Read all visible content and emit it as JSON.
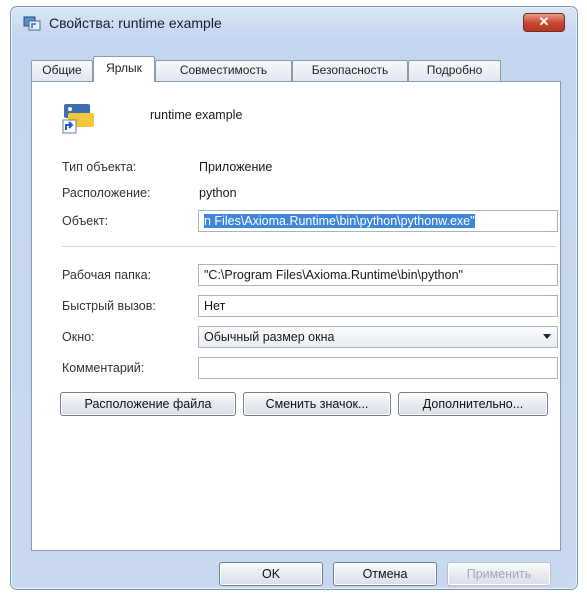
{
  "window": {
    "title": "Свойства: runtime example",
    "close_label": "✕"
  },
  "tabs": [
    {
      "label": "Общие",
      "active": false
    },
    {
      "label": "Ярлык",
      "active": true
    },
    {
      "label": "Совместимость",
      "active": false
    },
    {
      "label": "Безопасность",
      "active": false
    },
    {
      "label": "Подробно",
      "active": false
    }
  ],
  "shortcut": {
    "name": "runtime example",
    "type_label": "Тип объекта:",
    "type_value": "Приложение",
    "location_label": "Расположение:",
    "location_value": "python",
    "target_label": "Объект:",
    "target_value": "n Files\\Axioma.Runtime\\bin\\python\\pythonw.exe\"",
    "workdir_label": "Рабочая папка:",
    "workdir_value": "\"C:\\Program Files\\Axioma.Runtime\\bin\\python\"",
    "hotkey_label": "Быстрый вызов:",
    "hotkey_value": "Нет",
    "window_label": "Окно:",
    "window_value": "Обычный размер окна",
    "comment_label": "Комментарий:",
    "comment_value": ""
  },
  "panel_buttons": {
    "file_location": "Расположение файла",
    "change_icon": "Сменить значок...",
    "advanced": "Дополнительно..."
  },
  "dialog_buttons": {
    "ok": "OK",
    "cancel": "Отмена",
    "apply": "Применить"
  },
  "icons": {
    "app_icon": "shortcut-properties-icon",
    "program_icon": "python-shortcut-icon"
  }
}
